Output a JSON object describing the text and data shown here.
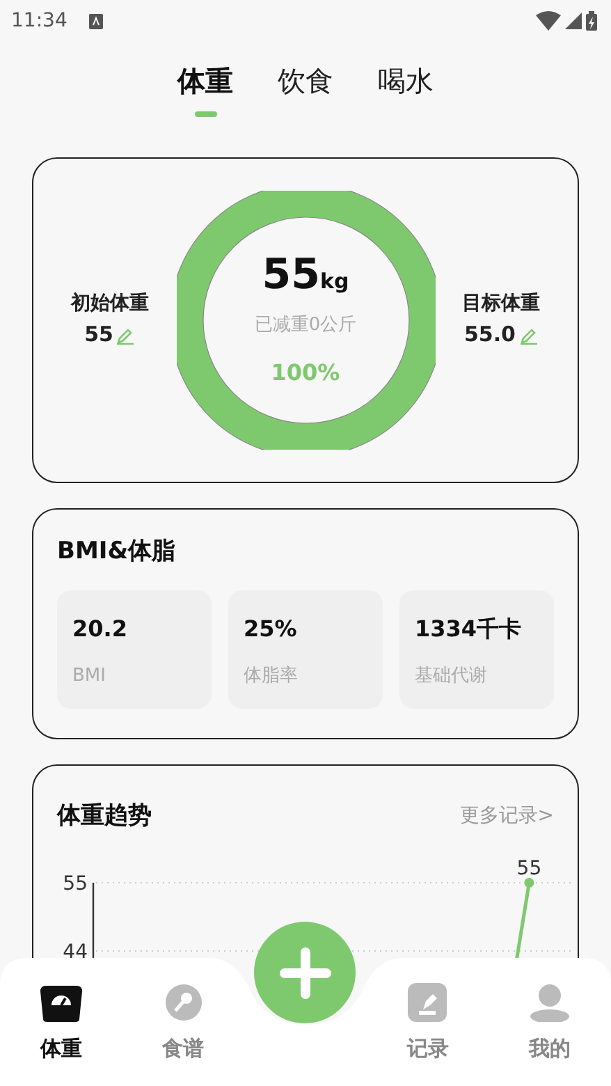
{
  "status_bar": {
    "time": "11:34"
  },
  "tabs": [
    {
      "label": "体重",
      "selected": true
    },
    {
      "label": "饮食",
      "selected": false
    },
    {
      "label": "喝水",
      "selected": false
    }
  ],
  "weight_card": {
    "start": {
      "label": "初始体重",
      "value": "55"
    },
    "current": {
      "value": "55",
      "unit": "kg",
      "lost": "已减重0公斤",
      "percent": "100%"
    },
    "target": {
      "label": "目标体重",
      "value": "55.0"
    }
  },
  "bmi_card": {
    "title": "BMI&体脂",
    "stats": [
      {
        "value": "20.2",
        "label": "BMI"
      },
      {
        "value": "25%",
        "label": "体脂率"
      },
      {
        "value": "1334千卡",
        "label": "基础代谢"
      }
    ]
  },
  "trend_card": {
    "title": "体重趋势",
    "more": "更多记录>",
    "chart_data": {
      "type": "line",
      "ylim": [
        44,
        55
      ],
      "yticks": [
        44,
        55
      ],
      "categories": [
        null,
        null,
        null,
        null,
        null
      ],
      "value_labels": [
        null,
        null,
        null,
        null,
        "55"
      ],
      "series": [
        {
          "color": "#7ec96e",
          "marker": "circle",
          "values": [
            null,
            null,
            null,
            null,
            55
          ]
        }
      ]
    }
  },
  "bottom_nav": [
    {
      "label": "体重",
      "selected": true
    },
    {
      "label": "食谱",
      "selected": false
    },
    {
      "kind": "add"
    },
    {
      "label": "记录",
      "selected": false
    },
    {
      "label": "我的",
      "selected": false
    }
  ]
}
